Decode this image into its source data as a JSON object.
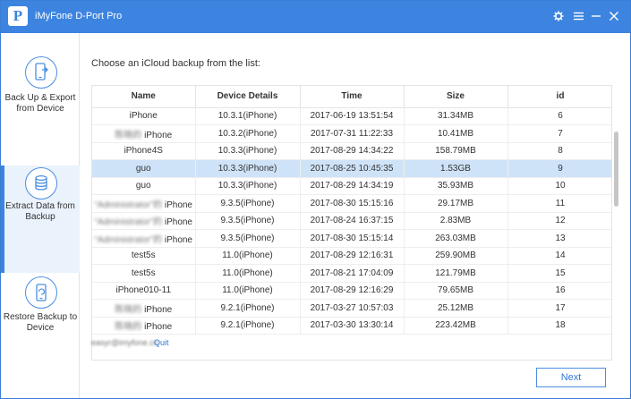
{
  "app": {
    "title": "iMyFone D-Port Pro",
    "logo_letter": "P",
    "accent_color": "#3c84e0"
  },
  "sidebar": {
    "items": [
      {
        "label": "Back Up & Export from Device",
        "icon": "phone-export-icon",
        "active": false
      },
      {
        "label": "Extract Data  from Backup",
        "icon": "database-backup-icon",
        "active": true
      },
      {
        "label": "Restore Backup to Device",
        "icon": "phone-restore-icon",
        "active": false
      }
    ]
  },
  "main": {
    "instruction": "Choose an iCloud backup from the list:",
    "columns": [
      "Name",
      "Device Details",
      "Time",
      "Size",
      "id"
    ],
    "rows": [
      {
        "name": "iPhone",
        "name_prefix": "",
        "device": "10.3.1(iPhone)",
        "time": "2017-06-19 13:51:54",
        "size": "31.34MB",
        "id": "6",
        "selected": false
      },
      {
        "name": "iPhone",
        "name_prefix": "陈晓的",
        "device": "10.3.2(iPhone)",
        "time": "2017-07-31 11:22:33",
        "size": "10.41MB",
        "id": "7",
        "selected": false
      },
      {
        "name": "iPhone4S",
        "name_prefix": "",
        "device": "10.3.3(iPhone)",
        "time": "2017-08-29 14:34:22",
        "size": "158.79MB",
        "id": "8",
        "selected": false
      },
      {
        "name": "guo",
        "name_prefix": "",
        "device": "10.3.3(iPhone)",
        "time": "2017-08-25 10:45:35",
        "size": "1.53GB",
        "id": "9",
        "selected": true
      },
      {
        "name": "guo",
        "name_prefix": "",
        "device": "10.3.3(iPhone)",
        "time": "2017-08-29 14:34:19",
        "size": "35.93MB",
        "id": "10",
        "selected": false
      },
      {
        "name": "iPhone",
        "name_prefix": "“Administrator”的",
        "device": "9.3.5(iPhone)",
        "time": "2017-08-30 15:15:16",
        "size": "29.17MB",
        "id": "11",
        "selected": false
      },
      {
        "name": "iPhone",
        "name_prefix": "“Administrator”的",
        "device": "9.3.5(iPhone)",
        "time": "2017-08-24 16:37:15",
        "size": "2.83MB",
        "id": "12",
        "selected": false
      },
      {
        "name": "iPhone",
        "name_prefix": "“Administrator”的",
        "device": "9.3.5(iPhone)",
        "time": "2017-08-30 15:15:14",
        "size": "263.03MB",
        "id": "13",
        "selected": false
      },
      {
        "name": "test5s",
        "name_prefix": "",
        "device": "11.0(iPhone)",
        "time": "2017-08-29 12:16:31",
        "size": "259.90MB",
        "id": "14",
        "selected": false
      },
      {
        "name": "test5s",
        "name_prefix": "",
        "device": "11.0(iPhone)",
        "time": "2017-08-21 17:04:09",
        "size": "121.79MB",
        "id": "15",
        "selected": false
      },
      {
        "name": "iPhone010-11",
        "name_prefix": "",
        "device": "11.0(iPhone)",
        "time": "2017-08-29 12:16:29",
        "size": "79.65MB",
        "id": "16",
        "selected": false
      },
      {
        "name": "iPhone",
        "name_prefix": "陈晓的",
        "device": "9.2.1(iPhone)",
        "time": "2017-03-27 10:57:03",
        "size": "25.12MB",
        "id": "17",
        "selected": false
      },
      {
        "name": "iPhone",
        "name_prefix": "陈晓的",
        "device": "9.2.1(iPhone)",
        "time": "2017-03-30 13:30:14",
        "size": "223.42MB",
        "id": "18",
        "selected": false
      }
    ],
    "account_email": "easyr@imyfone.cn",
    "quit_label": "Quit",
    "next_label": "Next",
    "selected_row_color": "#cfe3f8"
  }
}
